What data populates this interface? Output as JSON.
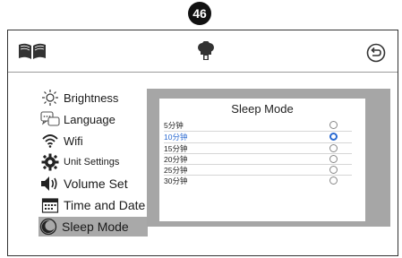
{
  "page_number": "46",
  "menu": {
    "items": [
      {
        "label": "Brightness",
        "icon": "brightness-icon"
      },
      {
        "label": "Language",
        "icon": "language-icon"
      },
      {
        "label": "Wifi",
        "icon": "wifi-icon"
      },
      {
        "label": "Unit Settings",
        "icon": "unit-settings-icon"
      },
      {
        "label": "Volume Set",
        "icon": "volume-icon"
      },
      {
        "label": "Time and Date",
        "icon": "calendar-icon"
      },
      {
        "label": "Sleep Mode",
        "icon": "sleep-mode-icon",
        "selected": true
      }
    ]
  },
  "sleep_mode": {
    "title": "Sleep Mode",
    "options": [
      {
        "label": "5分钟",
        "selected": false
      },
      {
        "label": "10分钟",
        "selected": true
      },
      {
        "label": "15分钟",
        "selected": false
      },
      {
        "label": "20分钟",
        "selected": false
      },
      {
        "label": "25分钟",
        "selected": false
      },
      {
        "label": "30分钟",
        "selected": false
      }
    ]
  },
  "colors": {
    "selected_accent": "#2a6ad1",
    "panel_gray": "#a6a6a6"
  }
}
